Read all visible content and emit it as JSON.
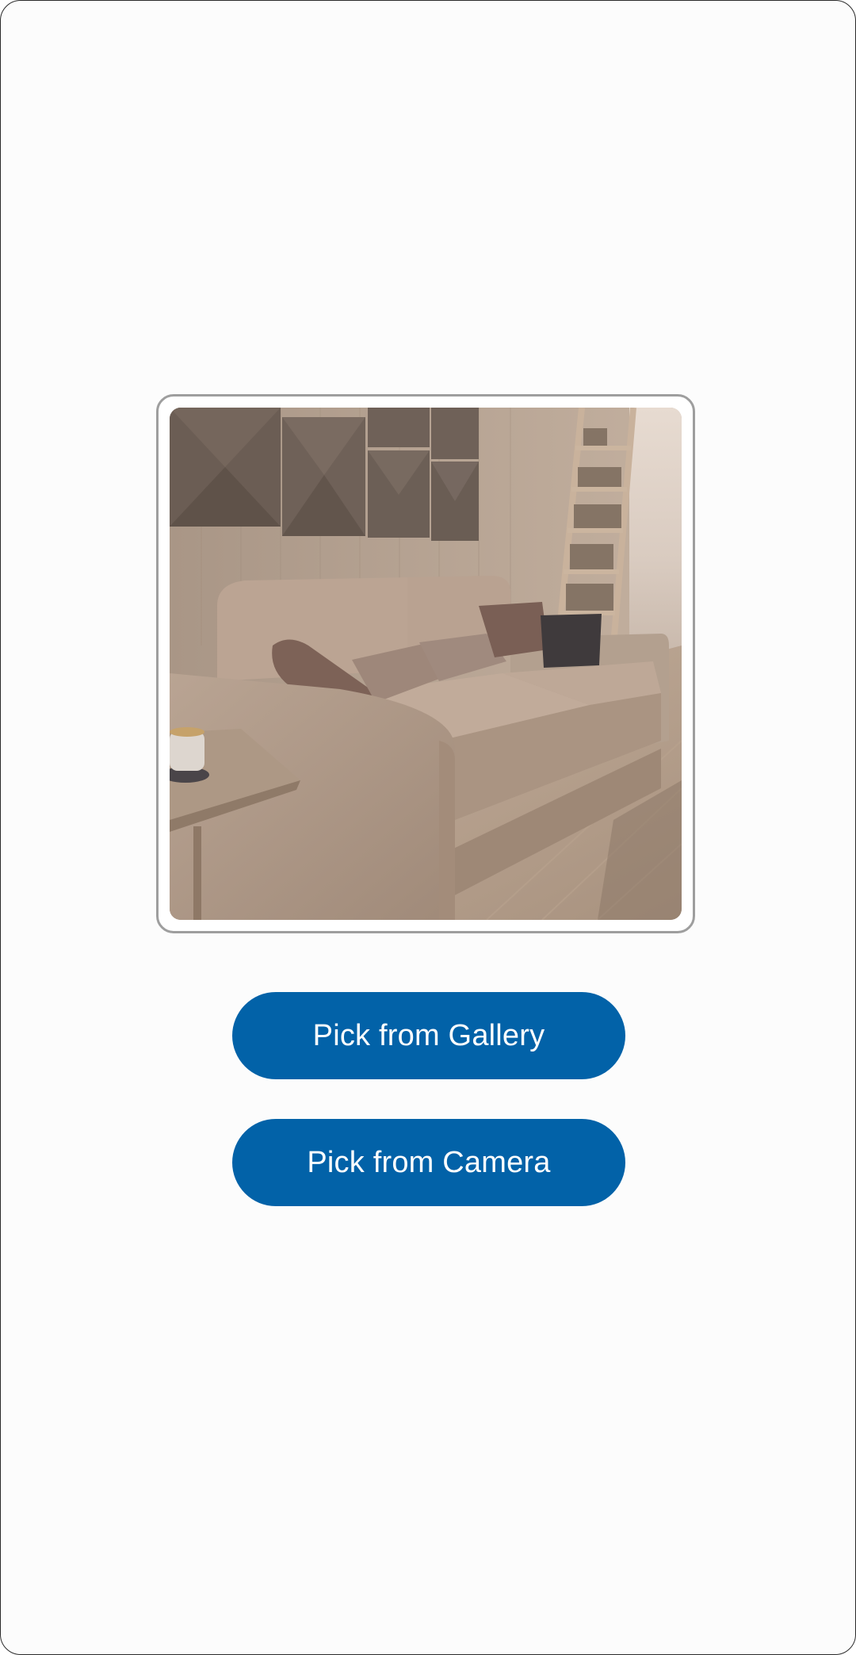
{
  "image_preview": {
    "icon": "sofa-photo",
    "description_colors": {
      "wall": "#b7a596",
      "panels": "#6d5f56",
      "sofa": "#bba595",
      "floor": "#c9b5a3"
    }
  },
  "buttons": {
    "gallery_label": "Pick from Gallery",
    "camera_label": "Pick from Camera"
  },
  "theme": {
    "accent": "#0262a8",
    "background": "#fcfcfc",
    "frame_border": "#9e9e9e"
  }
}
